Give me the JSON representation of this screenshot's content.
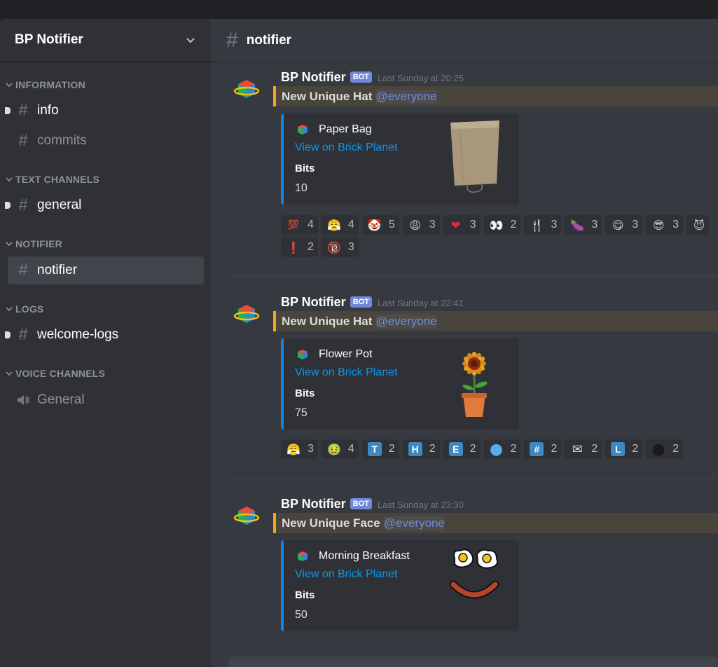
{
  "window": {
    "server_name": "BP Notifier"
  },
  "sidebar": {
    "categories": [
      {
        "label": "INFORMATION"
      },
      {
        "label": "TEXT CHANNELS"
      },
      {
        "label": "NOTIFIER"
      },
      {
        "label": "LOGS"
      },
      {
        "label": "VOICE CHANNELS"
      }
    ],
    "channels": {
      "info": "info",
      "commits": "commits",
      "general": "general",
      "notifier": "notifier",
      "welcome_logs": "welcome-logs",
      "voice_general": "General"
    }
  },
  "header": {
    "channel_name": "notifier",
    "hash_icon": "#"
  },
  "messages": [
    {
      "author": "BP Notifier",
      "bot_tag": "BOT",
      "timestamp": "Last Sunday at 20:25",
      "title": "New Unique Hat",
      "mention": "@everyone",
      "embed": {
        "item": "Paper Bag",
        "link": "View on Brick Planet",
        "field": "Bits",
        "value": "10"
      },
      "reactions": [
        {
          "icon": "hundred-points",
          "glyph": "💯",
          "count": "4"
        },
        {
          "icon": "face-with-steam",
          "glyph": "😤",
          "count": "4"
        },
        {
          "icon": "clown-face",
          "glyph": "🤡",
          "count": "5"
        },
        {
          "icon": "weary-face",
          "glyph": "😩",
          "count": "3"
        },
        {
          "icon": "red-heart",
          "glyph": "❤",
          "count": "3"
        },
        {
          "icon": "eyes",
          "glyph": "👀",
          "count": "2"
        },
        {
          "icon": "fork-and-knife",
          "glyph": "🍴",
          "count": "3"
        },
        {
          "icon": "eggplant",
          "glyph": "🍆",
          "count": "3"
        },
        {
          "icon": "face-savoring-food",
          "glyph": "😋",
          "count": "3"
        },
        {
          "icon": "smiling-face-sunglasses",
          "glyph": "😎",
          "count": "3"
        },
        {
          "icon": "smiling-imp",
          "glyph": "😈",
          "count": ""
        },
        {
          "icon": "exclamation-mark",
          "glyph": "❗",
          "count": "2"
        },
        {
          "icon": "no-one-under-eighteen",
          "glyph": "🔞",
          "count": "3"
        }
      ]
    },
    {
      "author": "BP Notifier",
      "bot_tag": "BOT",
      "timestamp": "Last Sunday at 22:41",
      "title": "New Unique Hat",
      "mention": "@everyone",
      "embed": {
        "item": "Flower Pot",
        "link": "View on Brick Planet",
        "field": "Bits",
        "value": "75"
      },
      "reactions": [
        {
          "icon": "face-with-steam",
          "glyph": "😤",
          "count": "3"
        },
        {
          "icon": "nauseated-face",
          "glyph": "🤢",
          "count": "4"
        },
        {
          "icon": "regional-t",
          "glyph": "T",
          "count": "2"
        },
        {
          "icon": "regional-h",
          "glyph": "H",
          "count": "2"
        },
        {
          "icon": "regional-e",
          "glyph": "E",
          "count": "2"
        },
        {
          "icon": "blue-circle",
          "glyph": "●",
          "count": "2"
        },
        {
          "icon": "keycap-hash",
          "glyph": "#",
          "count": "2"
        },
        {
          "icon": "envelope",
          "glyph": "✉",
          "count": "2"
        },
        {
          "icon": "regional-l",
          "glyph": "L",
          "count": "2"
        },
        {
          "icon": "black-circle",
          "glyph": "●",
          "count": "2"
        }
      ]
    },
    {
      "author": "BP Notifier",
      "bot_tag": "BOT",
      "timestamp": "Last Sunday at 23:30",
      "title": "New Unique Face",
      "mention": "@everyone",
      "embed": {
        "item": "Morning Breakfast",
        "link": "View on Brick Planet",
        "field": "Bits",
        "value": "50"
      },
      "reactions": []
    }
  ],
  "colors": {
    "accent_blurple": "#7289da",
    "mention_bar": "#faa61a",
    "embed_border": "#0a85ea",
    "link": "#0b96ec"
  }
}
